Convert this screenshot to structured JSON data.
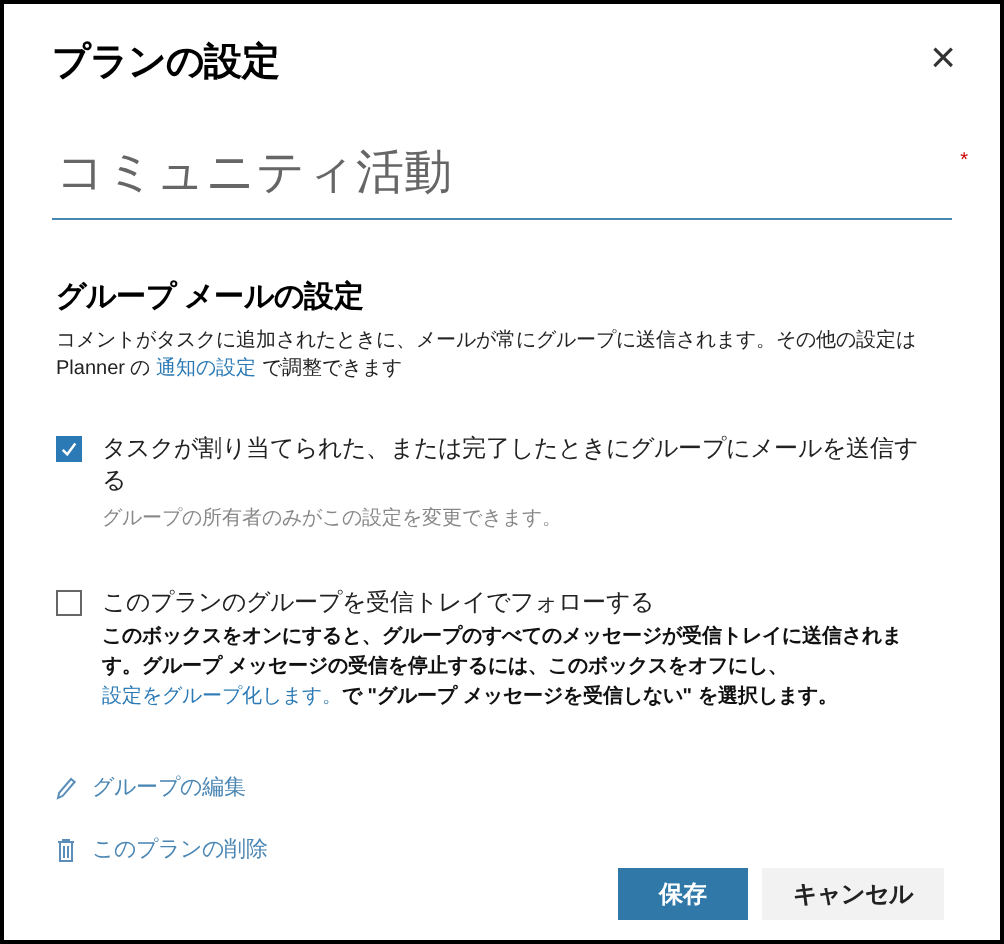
{
  "dialog": {
    "title": "プランの設定",
    "close": "×"
  },
  "plan_name": {
    "value": "コミュニティ活動",
    "required": "*"
  },
  "email_settings": {
    "heading": "グループ メールの設定",
    "description": {
      "before": "コメントがタスクに追加されたときに、メールが常にグループに送信されます。その他の設定は Planner の ",
      "link": "通知の設定",
      "after": " で調整できます"
    }
  },
  "options": [
    {
      "label": "タスクが割り当てられた、または完了したときにグループにメールを送信する",
      "checked": true,
      "note": {
        "kind": "hint",
        "before": "グループの所有者のみがこの設定を変更できます。"
      }
    },
    {
      "label": "このプランのグループを受信トレイでフォローする",
      "checked": false,
      "note": {
        "kind": "info",
        "before": "このボックスをオンにすると、グループのすべてのメッセージが受信トレイに送信されます。グループ メッセージの受信を停止するには、このボックスをオフにし、",
        "link": "設定をグループ化します。",
        "after": "で \"グループ メッセージを受信しない\" を選択します。"
      }
    }
  ],
  "actions": [
    {
      "kind": "edit",
      "label": "グループの編集"
    },
    {
      "kind": "delete",
      "label": "このプランの削除"
    }
  ],
  "buttons": [
    {
      "kind": "primary",
      "label": "保存"
    },
    {
      "kind": "secondary",
      "label": "キャンセル"
    }
  ]
}
